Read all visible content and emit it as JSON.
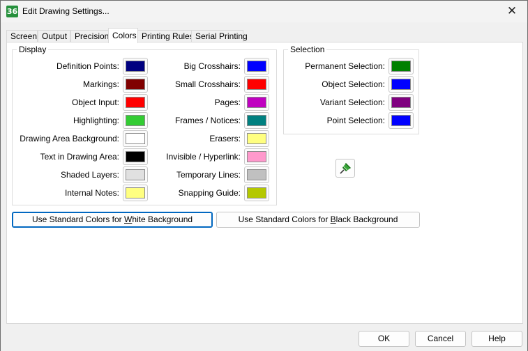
{
  "window": {
    "title": "Edit Drawing Settings...",
    "app_icon_text": "36",
    "close_glyph": "✕"
  },
  "tabs": [
    {
      "label": "Screen",
      "active": false
    },
    {
      "label": "Output",
      "active": false
    },
    {
      "label": "Precision",
      "active": false
    },
    {
      "label": "Colors",
      "active": true
    },
    {
      "label": "Printing Rules",
      "active": false
    },
    {
      "label": "Serial Printing",
      "active": false
    }
  ],
  "display": {
    "legend": "Display",
    "left_column": [
      {
        "label": "Definition Points:",
        "color": "#000080"
      },
      {
        "label": "Markings:",
        "color": "#800000"
      },
      {
        "label": "Object Input:",
        "color": "#ff0000"
      },
      {
        "label": "Highlighting:",
        "color": "#33cc33"
      },
      {
        "label": "Drawing Area Background:",
        "color": "#ffffff"
      },
      {
        "label": "Text in Drawing Area:",
        "color": "#000000"
      },
      {
        "label": "Shaded Layers:",
        "color": "#e0e0e0"
      },
      {
        "label": "Internal Notes:",
        "color": "#ffff80"
      }
    ],
    "right_column": [
      {
        "label": "Big Crosshairs:",
        "color": "#0000ff"
      },
      {
        "label": "Small Crosshairs:",
        "color": "#ff0000"
      },
      {
        "label": "Pages:",
        "color": "#c000c0"
      },
      {
        "label": "Frames / Notices:",
        "color": "#008080"
      },
      {
        "label": "Erasers:",
        "color": "#ffff80"
      },
      {
        "label": "Invisible / Hyperlink:",
        "color": "#ff99cc"
      },
      {
        "label": "Temporary Lines:",
        "color": "#c0c0c0"
      },
      {
        "label": "Snapping Guide:",
        "color": "#b4c800"
      }
    ]
  },
  "selection": {
    "legend": "Selection",
    "items": [
      {
        "label": "Permanent Selection:",
        "color": "#008000"
      },
      {
        "label": "Object Selection:",
        "color": "#0000ff"
      },
      {
        "label": "Variant Selection:",
        "color": "#800080"
      },
      {
        "label": "Point Selection:",
        "color": "#0000ff"
      }
    ]
  },
  "pin_icon": "pushpin-icon",
  "standard_buttons": {
    "white_pre": "Use Standard Colors for ",
    "white_key": "W",
    "white_post": "hite Background",
    "black_pre": "Use Standard Colors for ",
    "black_key": "B",
    "black_post": "lack Background"
  },
  "footer": {
    "ok": "OK",
    "cancel": "Cancel",
    "help": "Help"
  }
}
